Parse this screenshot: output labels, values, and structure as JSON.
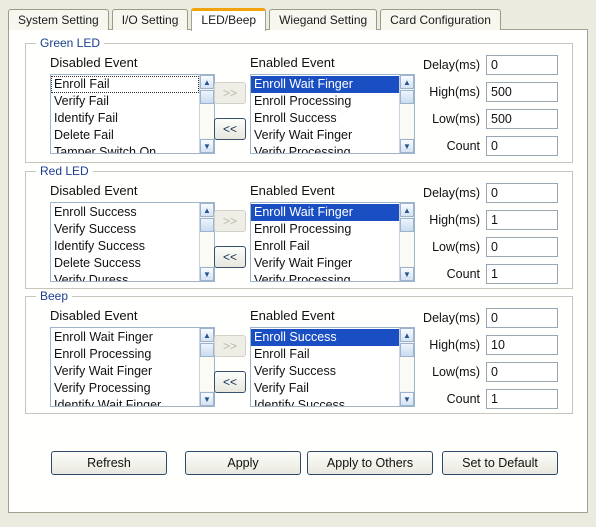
{
  "tabs": [
    {
      "label": "System Setting",
      "active": false
    },
    {
      "label": "I/O Setting",
      "active": false
    },
    {
      "label": "LED/Beep",
      "active": true
    },
    {
      "label": "Wiegand Setting",
      "active": false
    },
    {
      "label": "Card Configuration",
      "active": false
    }
  ],
  "colors": {
    "active_tab_accent": "#f0a30a",
    "legend_text": "#1b3f8f",
    "selection": "#1a4fc4",
    "panel_bg": "#fffffe",
    "window_bg": "#ecebdf"
  },
  "labels": {
    "disabled_event": "Disabled Event",
    "enabled_event": "Enabled Event",
    "delay": "Delay(ms)",
    "high": "High(ms)",
    "low": "Low(ms)",
    "count": "Count",
    "move_right": ">>",
    "move_left": "<<"
  },
  "groups": [
    {
      "id": "green-led",
      "legend": "Green LED",
      "disabled_events": [
        {
          "label": "Enroll Fail",
          "focused": true
        },
        {
          "label": "Verify Fail",
          "focused": false
        },
        {
          "label": "Identify Fail",
          "focused": false
        },
        {
          "label": "Delete Fail",
          "focused": false
        },
        {
          "label": "Tamper Switch On",
          "focused": false
        }
      ],
      "enabled_events": [
        {
          "label": "Enroll Wait Finger",
          "selected": true
        },
        {
          "label": "Enroll Processing",
          "selected": false
        },
        {
          "label": "Enroll Success",
          "selected": false
        },
        {
          "label": "Verify Wait Finger",
          "selected": false
        },
        {
          "label": "Verify Processing",
          "selected": false
        }
      ],
      "move_right_enabled": false,
      "move_left_enabled": true,
      "values": {
        "delay": "0",
        "high": "500",
        "low": "500",
        "count": "0"
      }
    },
    {
      "id": "red-led",
      "legend": "Red LED",
      "disabled_events": [
        {
          "label": "Enroll Success",
          "focused": false
        },
        {
          "label": "Verify Success",
          "focused": false
        },
        {
          "label": "Identify Success",
          "focused": false
        },
        {
          "label": "Delete Success",
          "focused": false
        },
        {
          "label": "Verify Duress",
          "focused": false
        }
      ],
      "enabled_events": [
        {
          "label": "Enroll Wait Finger",
          "selected": true
        },
        {
          "label": "Enroll Processing",
          "selected": false
        },
        {
          "label": "Enroll Fail",
          "selected": false
        },
        {
          "label": "Verify Wait Finger",
          "selected": false
        },
        {
          "label": "Verify Processing",
          "selected": false
        }
      ],
      "move_right_enabled": false,
      "move_left_enabled": true,
      "values": {
        "delay": "0",
        "high": "1",
        "low": "0",
        "count": "1"
      }
    },
    {
      "id": "beep",
      "legend": "Beep",
      "disabled_events": [
        {
          "label": "Enroll Wait Finger",
          "focused": false
        },
        {
          "label": "Enroll Processing",
          "focused": false
        },
        {
          "label": "Verify Wait Finger",
          "focused": false
        },
        {
          "label": "Verify Processing",
          "focused": false
        },
        {
          "label": "Identify Wait Finger",
          "focused": false
        }
      ],
      "enabled_events": [
        {
          "label": "Enroll Success",
          "selected": true
        },
        {
          "label": "Enroll Fail",
          "selected": false
        },
        {
          "label": "Verify Success",
          "selected": false
        },
        {
          "label": "Verify Fail",
          "selected": false
        },
        {
          "label": "Identify Success",
          "selected": false
        }
      ],
      "move_right_enabled": false,
      "move_left_enabled": true,
      "values": {
        "delay": "0",
        "high": "10",
        "low": "0",
        "count": "1"
      }
    }
  ],
  "footer_buttons": [
    {
      "label": "Refresh"
    },
    {
      "label": "Apply"
    },
    {
      "label": "Apply to Others"
    },
    {
      "label": "Set to Default"
    }
  ]
}
